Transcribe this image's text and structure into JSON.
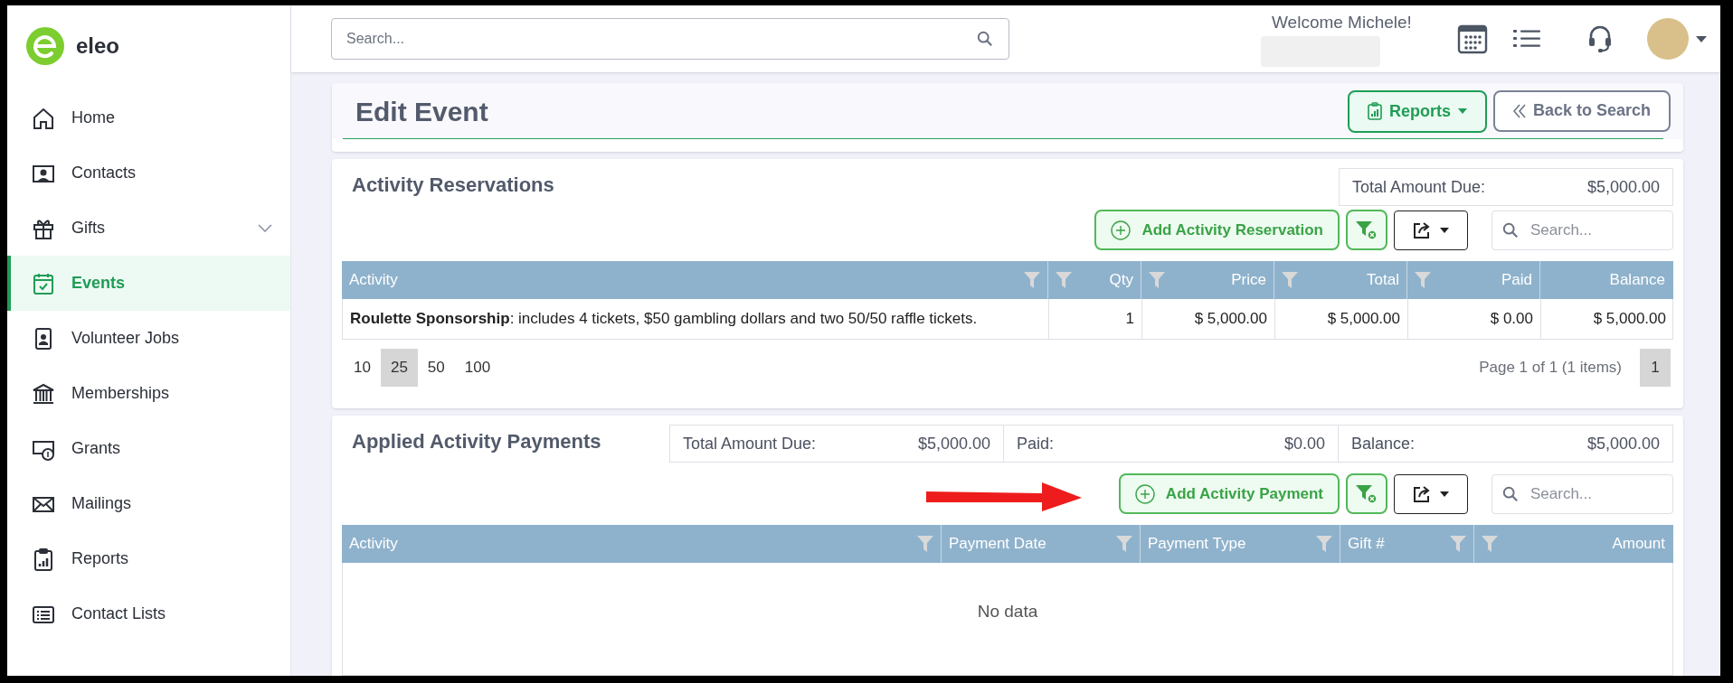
{
  "brand": {
    "name": "eleo"
  },
  "sidebar": {
    "items": [
      {
        "label": "Home",
        "kind": "link",
        "selected": false
      },
      {
        "label": "Contacts",
        "kind": "link",
        "selected": false
      },
      {
        "label": "Gifts",
        "kind": "group",
        "selected": false
      },
      {
        "label": "Events",
        "kind": "link",
        "selected": true
      },
      {
        "label": "Volunteer Jobs",
        "kind": "link",
        "selected": false
      },
      {
        "label": "Memberships",
        "kind": "link",
        "selected": false
      },
      {
        "label": "Grants",
        "kind": "link",
        "selected": false
      },
      {
        "label": "Mailings",
        "kind": "link",
        "selected": false
      },
      {
        "label": "Reports",
        "kind": "link",
        "selected": false
      },
      {
        "label": "Contact Lists",
        "kind": "link",
        "selected": false
      }
    ]
  },
  "header": {
    "search": {
      "placeholder": "Search..."
    },
    "welcome": "Welcome Michele!"
  },
  "page": {
    "title": "Edit Event",
    "buttons": [
      {
        "label": "Reports",
        "kind": "primary"
      },
      {
        "label": "Back to Search",
        "kind": "back"
      }
    ]
  },
  "reservations": {
    "title": "Activity Reservations",
    "summary": [
      {
        "label": "Total Amount Due:",
        "value": "$5,000.00"
      }
    ],
    "add_button": "Add Activity Reservation",
    "search": {
      "placeholder": "Search..."
    },
    "table": {
      "columns": [
        {
          "label": "Activity",
          "filterable": true,
          "align_right": false
        },
        {
          "label": "Qty",
          "filterable": true,
          "align_right": true
        },
        {
          "label": "Price",
          "filterable": true,
          "align_right": true
        },
        {
          "label": "Total",
          "filterable": true,
          "align_right": true
        },
        {
          "label": "Paid",
          "filterable": true,
          "align_right": true
        },
        {
          "label": "Balance",
          "filterable": false,
          "align_right": true
        }
      ],
      "rows": [
        [
          "**Roulette Sponsorship**: includes 4 tickets, $50 gambling dollars and two 50/50 raffle tickets.",
          "1",
          "$ 5,000.00",
          "$ 5,000.00",
          "$ 0.00",
          "$ 5,000.00"
        ]
      ]
    },
    "pager": {
      "page_sizes": [
        {
          "label": "10",
          "selected": false
        },
        {
          "label": "25",
          "selected": true
        },
        {
          "label": "50",
          "selected": false
        },
        {
          "label": "100",
          "selected": false
        }
      ],
      "page_info": "Page 1 of 1 (1 items)",
      "pages": [
        {
          "label": "1",
          "selected": true
        }
      ]
    }
  },
  "payments": {
    "title": "Applied Activity Payments",
    "summary": [
      {
        "label": "Total Amount Due:",
        "value": "$5,000.00"
      },
      {
        "label": "Paid:",
        "value": "$0.00"
      },
      {
        "label": "Balance:",
        "value": "$5,000.00"
      }
    ],
    "add_button": "Add Activity Payment",
    "search": {
      "placeholder": "Search..."
    },
    "table": {
      "columns": [
        {
          "label": "Activity",
          "filterable": true,
          "align_right": false
        },
        {
          "label": "Payment Date",
          "filterable": true,
          "align_right": false
        },
        {
          "label": "Payment Type",
          "filterable": true,
          "align_right": false
        },
        {
          "label": "Gift #",
          "filterable": true,
          "align_right": false
        },
        {
          "label": "Amount",
          "filterable": true,
          "align_right": true
        }
      ],
      "empty_text": "No data"
    }
  }
}
